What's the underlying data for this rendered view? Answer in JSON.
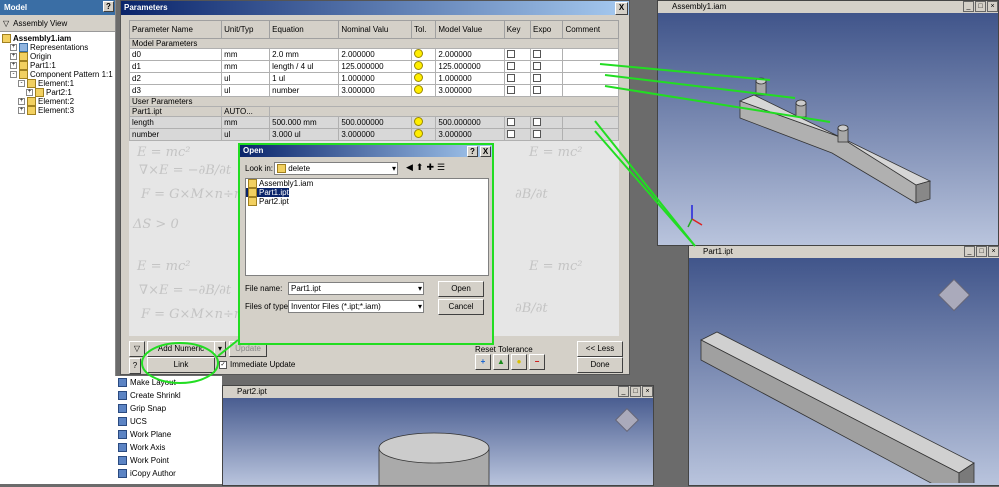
{
  "browser": {
    "header": "Model",
    "help_btn": "?",
    "view_label": "Assembly View",
    "items": [
      {
        "label": "Assembly1.iam",
        "indent": 0,
        "pm": ""
      },
      {
        "label": "Representations",
        "indent": 1,
        "pm": "+"
      },
      {
        "label": "Origin",
        "indent": 1,
        "pm": "+"
      },
      {
        "label": "Part1:1",
        "indent": 1,
        "pm": "+"
      },
      {
        "label": "Component Pattern 1:1",
        "indent": 1,
        "pm": "-"
      },
      {
        "label": "Element:1",
        "indent": 2,
        "pm": "-"
      },
      {
        "label": "Part2:1",
        "indent": 3,
        "pm": "+"
      },
      {
        "label": "Element:2",
        "indent": 2,
        "pm": "+"
      },
      {
        "label": "Element:3",
        "indent": 2,
        "pm": "+"
      }
    ]
  },
  "params": {
    "title": "Parameters",
    "close": "X",
    "columns": [
      "Parameter Name",
      "Unit/Typ",
      "Equation",
      "Nominal Valu",
      "Tol.",
      "Model Value",
      "Key",
      "Expo",
      "Comment"
    ],
    "model_group": "Model Parameters",
    "model_rows": [
      {
        "name": "d0",
        "unit": "mm",
        "eq": "2.0 mm",
        "nom": "2.000000",
        "model": "2.000000"
      },
      {
        "name": "d1",
        "unit": "mm",
        "eq": "length / 4 ul",
        "nom": "125.000000",
        "model": "125.000000"
      },
      {
        "name": "d2",
        "unit": "ul",
        "eq": "1 ul",
        "nom": "1.000000",
        "model": "1.000000"
      },
      {
        "name": "d3",
        "unit": "ul",
        "eq": "number",
        "nom": "3.000000",
        "model": "3.000000"
      }
    ],
    "user_group": "User Parameters",
    "link_row": {
      "name": "Part1.ipt",
      "unit": "AUTO..."
    },
    "linked_rows": [
      {
        "name": "length",
        "unit": "mm",
        "eq": "500.000 mm",
        "nom": "500.000000",
        "model": "500.000000"
      },
      {
        "name": "number",
        "unit": "ul",
        "eq": "3.000 ul",
        "nom": "3.000000",
        "model": "3.000000"
      }
    ],
    "add_numeric": "Add Numeric",
    "update": "Update",
    "link": "Link",
    "immediate_update": "Immediate Update",
    "reset_tolerance": "Reset Tolerance",
    "less": "<< Less",
    "done": "Done",
    "help": "?"
  },
  "open": {
    "title": "Open",
    "help_btn": "?",
    "close": "X",
    "look_in_label": "Look in:",
    "look_in_value": "delete",
    "files": [
      {
        "name": "Assembly1.iam",
        "selected": false
      },
      {
        "name": "Part1.ipt",
        "selected": true
      },
      {
        "name": "Part2.ipt",
        "selected": false
      }
    ],
    "filename_label": "File name:",
    "filename_value": "Part1.ipt",
    "filetype_label": "Files of type:",
    "filetype_value": "Inventor Files (*.ipt;*.iam)",
    "open_btn": "Open",
    "cancel_btn": "Cancel"
  },
  "viewports": {
    "assembly_title": "Assembly1.iam",
    "part1_title": "Part1.ipt",
    "part2_title": "Part2.ipt"
  },
  "panelbar": {
    "items": [
      "Make Layout",
      "Create Shrinkl",
      "Grip Snap",
      "UCS",
      "Work Plane",
      "Work Axis",
      "Work Point",
      "iCopy Author"
    ]
  },
  "colors": {
    "highlight": "#22dd22",
    "titlebar": "#0a246a"
  }
}
